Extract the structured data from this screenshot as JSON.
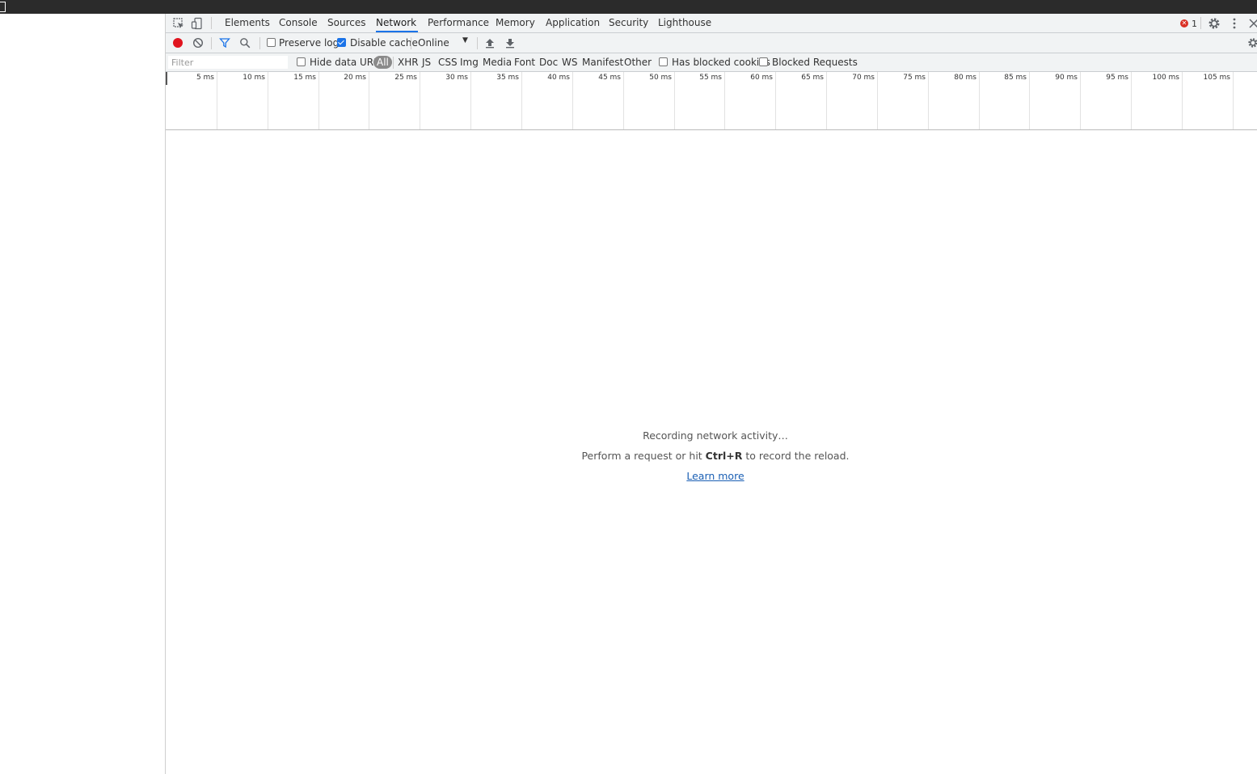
{
  "tabs": [
    "Elements",
    "Console",
    "Sources",
    "Network",
    "Performance",
    "Memory",
    "Application",
    "Security",
    "Lighthouse"
  ],
  "active_tab": "Network",
  "error_count": "1",
  "toolbar": {
    "preserve_log": "Preserve log",
    "preserve_log_checked": false,
    "disable_cache": "Disable cache",
    "disable_cache_checked": true,
    "throttling": "Online"
  },
  "filter": {
    "placeholder": "Filter",
    "hide_data_urls": "Hide data URLs",
    "types": [
      "All",
      "XHR",
      "JS",
      "CSS",
      "Img",
      "Media",
      "Font",
      "Doc",
      "WS",
      "Manifest",
      "Other"
    ],
    "active_type": "All",
    "has_blocked_cookies": "Has blocked cookies",
    "blocked_requests": "Blocked Requests"
  },
  "timeline_ticks": [
    "5 ms",
    "10 ms",
    "15 ms",
    "20 ms",
    "25 ms",
    "30 ms",
    "35 ms",
    "40 ms",
    "45 ms",
    "50 ms",
    "55 ms",
    "60 ms",
    "65 ms",
    "70 ms",
    "75 ms",
    "80 ms",
    "85 ms",
    "90 ms",
    "95 ms",
    "100 ms",
    "105 ms"
  ],
  "empty_state": {
    "line1": "Recording network activity…",
    "line2_pre": "Perform a request or hit ",
    "line2_key": "Ctrl+R",
    "line2_post": " to record the reload.",
    "link": "Learn more"
  },
  "colors": {
    "record": "#e0141e",
    "accent": "#1a73e8",
    "link": "#1a5fb4"
  }
}
